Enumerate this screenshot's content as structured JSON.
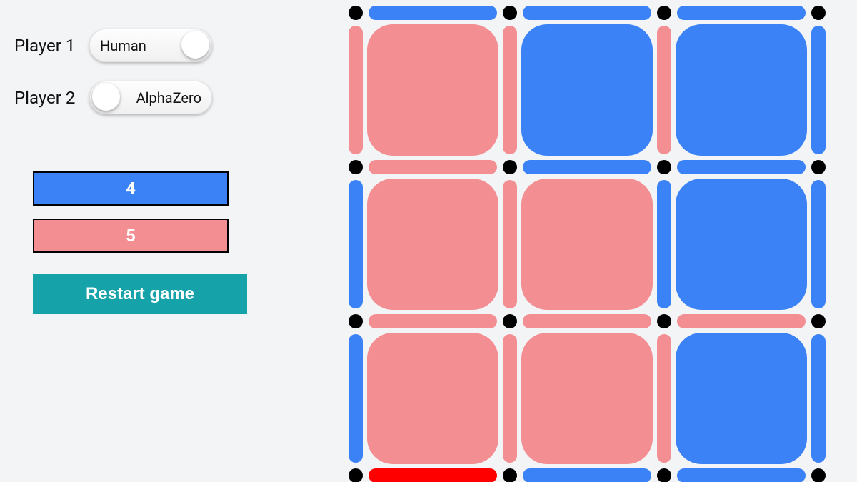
{
  "colors": {
    "player1": "#3b82f6",
    "player2": "#f38f93",
    "highlight": "#ff0000",
    "restart_bg": "#16a2a9",
    "dot": "#000000",
    "page_bg": "#f3f4f6"
  },
  "panel": {
    "player1_label": "Player 1",
    "player2_label": "Player 2",
    "player1_toggle": {
      "position": "right",
      "text": "Human"
    },
    "player2_toggle": {
      "position": "left",
      "text": "AlphaZero"
    },
    "score_p1": "4",
    "score_p2": "5",
    "restart_label": "Restart game"
  },
  "board": {
    "grid_size": 4,
    "legend": {
      "1": "player1/blue",
      "2": "player2/pink",
      "3": "highlight/red"
    },
    "cells": [
      [
        2,
        1,
        1
      ],
      [
        2,
        2,
        1
      ],
      [
        2,
        2,
        1
      ]
    ],
    "h_edges": [
      [
        1,
        1,
        1
      ],
      [
        2,
        1,
        1
      ],
      [
        2,
        2,
        2
      ],
      [
        3,
        1,
        1
      ]
    ],
    "v_edges": [
      [
        2,
        2,
        2,
        1
      ],
      [
        1,
        2,
        1,
        1
      ],
      [
        1,
        2,
        2,
        1
      ]
    ]
  }
}
